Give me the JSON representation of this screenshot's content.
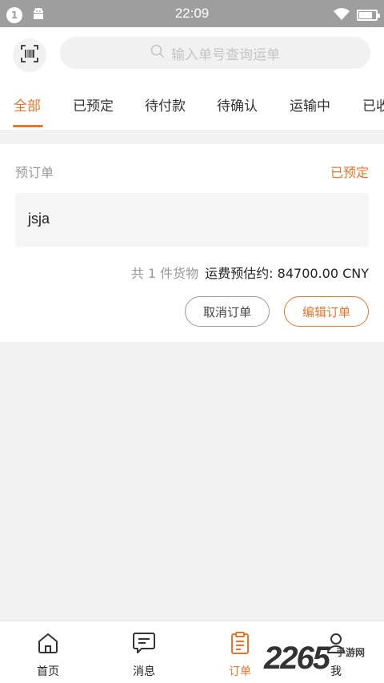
{
  "status_bar": {
    "notification_count": "1",
    "time": "22:09",
    "battery_level": 0.8,
    "icons": [
      "android-icon",
      "wifi-icon",
      "battery-icon"
    ]
  },
  "search": {
    "placeholder": "输入单号查询运单",
    "scan_icon": "barcode-scan-icon",
    "search_icon": "search-icon"
  },
  "tabs": [
    {
      "label": "全部",
      "active": true
    },
    {
      "label": "已预定",
      "active": false
    },
    {
      "label": "待付款",
      "active": false
    },
    {
      "label": "待确认",
      "active": false
    },
    {
      "label": "运输中",
      "active": false
    },
    {
      "label": "已收",
      "active": false
    }
  ],
  "order": {
    "type": "预订单",
    "status": "已预定",
    "name": "jsja",
    "goods_count": "共 1 件货物",
    "freight_estimate": "运费预估约: 84700.00 CNY",
    "cancel_label": "取消订单",
    "edit_label": "编辑订单"
  },
  "bottom_nav": [
    {
      "label": "首页",
      "icon": "home-icon",
      "active": false
    },
    {
      "label": "消息",
      "icon": "message-icon",
      "active": false
    },
    {
      "label": "订单",
      "icon": "order-icon",
      "active": true
    },
    {
      "label": "我",
      "icon": "profile-icon",
      "active": false
    }
  ],
  "watermark": {
    "number": "2265",
    "text": "手游网"
  },
  "colors": {
    "accent": "#e5762a",
    "status_bar": "#9e9e9e",
    "background": "#f2f2f2"
  }
}
